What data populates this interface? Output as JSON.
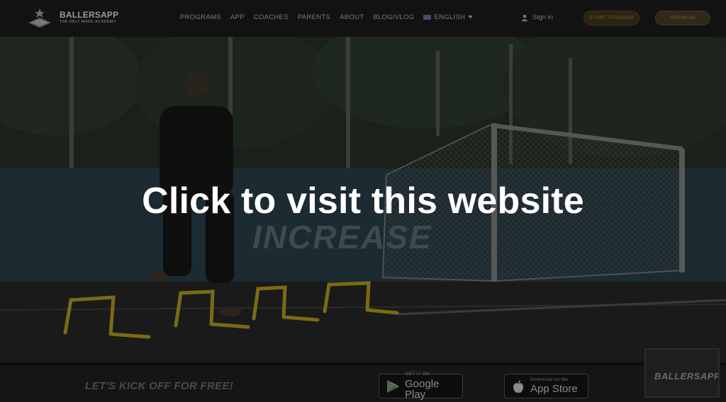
{
  "navbar": {
    "logo_name": "BALLERSAPP",
    "logo_tagline": "THE SELF MADE ACADEMY",
    "links": [
      "PROGRAMS",
      "APP",
      "COACHES",
      "PARENTS",
      "ABOUT",
      "BLOG/VLOG"
    ],
    "language": "ENGLISH",
    "signin": "Sign in",
    "start_training": "START TRAINING",
    "premium": "PREMIUM"
  },
  "hero": {
    "overlay_text": "Click to visit this website",
    "banner_word": "INCREASE"
  },
  "footer": {
    "kickoff": "LET'S KICK OFF FOR FREE!",
    "google_play_small": "GET IT ON",
    "google_play_big": "Google Play",
    "app_store_small": "Download on the",
    "app_store_big": "App Store",
    "thumb_text": "BALLERSAPP"
  },
  "colors": {
    "overlay_text": "#ffffff",
    "accent_gold": "#6a5630",
    "hurdles": "#7a6a14",
    "background": "#0a0a0a"
  },
  "icons": [
    "ballersapp-logo-icon",
    "flag-icon",
    "chevron-down-icon",
    "user-icon",
    "google-play-icon",
    "apple-icon"
  ]
}
